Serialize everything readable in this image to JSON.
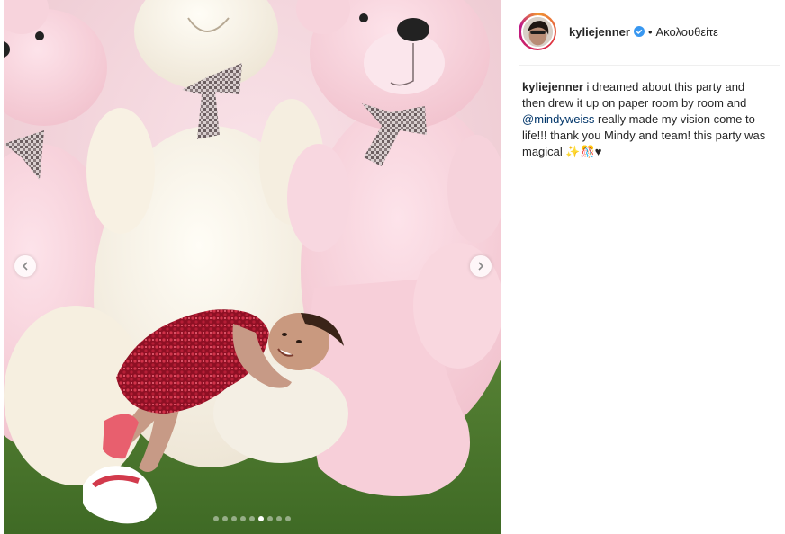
{
  "post": {
    "image_alt": "toddler lying on a plush teddy bear among giant pink and white teddy bears",
    "carousel": {
      "dot_count": 9,
      "active_index": 5
    },
    "nav": {
      "prev_icon": "chevron-left-icon",
      "next_icon": "chevron-right-icon"
    }
  },
  "header": {
    "username": "kyliejenner",
    "verified_icon": "verified-badge-icon",
    "separator": "•",
    "follow_label": "Ακολουθείτε"
  },
  "caption": {
    "username": "kyliejenner",
    "text_before": " i dreamed about this party and then drew it up on paper room by room and ",
    "mention": "@mindyweiss",
    "text_after": " really made my vision come to life!!! thank you Mindy and team! this party was magical ✨🎊♥"
  },
  "colors": {
    "mention": "#003569",
    "verified": "#3897f0",
    "text": "#262626"
  }
}
